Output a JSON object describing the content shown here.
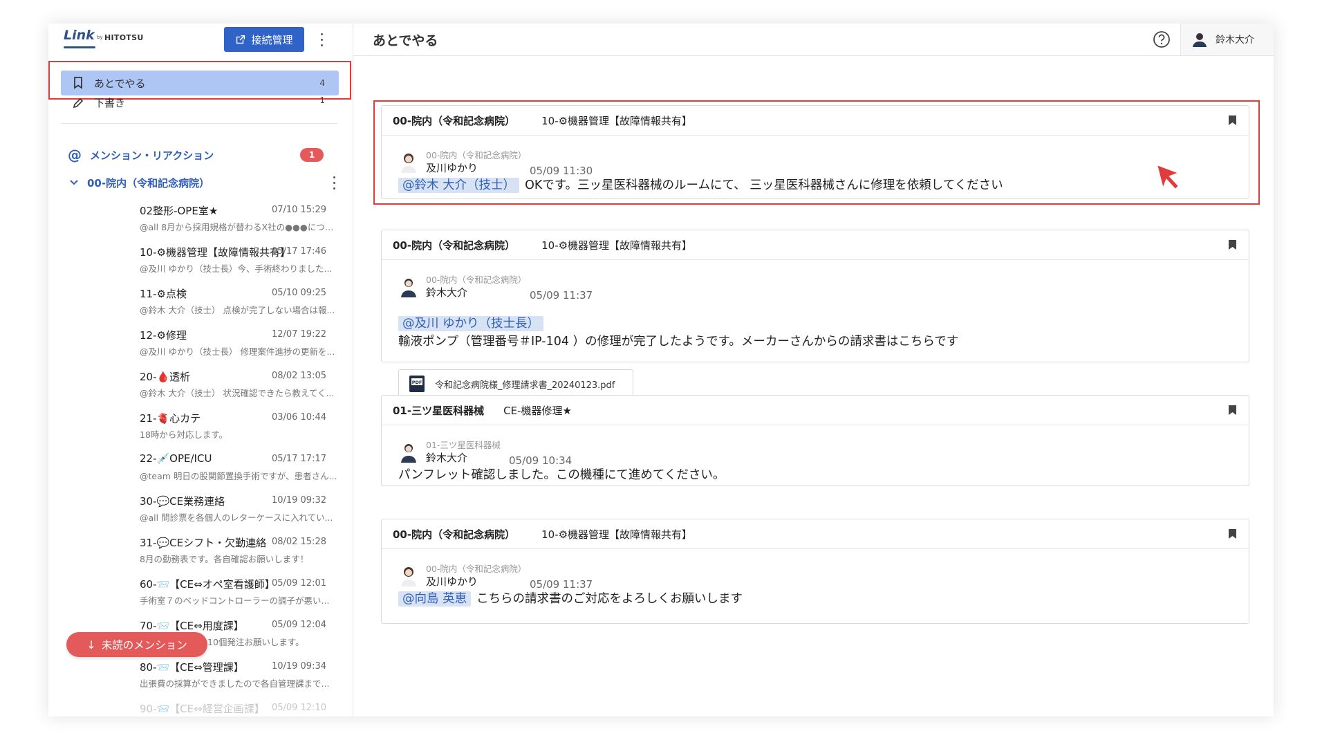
{
  "logo": {
    "brand": "Link",
    "by": "by",
    "company": "HITOTSU"
  },
  "sidebar": {
    "connection_button": "接続管理",
    "nav": [
      {
        "label": "あとでやる",
        "count": "4",
        "icon": "bookmark-icon"
      },
      {
        "label": "下書き",
        "count": "1",
        "icon": "pencil-icon"
      }
    ],
    "mentions": {
      "label": "メンション・リアクション",
      "count": "1"
    },
    "group": {
      "label": "00-院内（令和記念病院）"
    },
    "channels": [
      {
        "name": "02整形-OPE室★",
        "time": "07/10 15:29",
        "preview": "@all 8月から採用規格が替わるX社の●●●につい..."
      },
      {
        "name": "10-⚙機器管理【故障情報共有】",
        "time": "05/17 17:46",
        "preview": "@及川 ゆかり（技士長）今、手術終わりました..."
      },
      {
        "name": "11-⚙点検",
        "time": "05/10 09:25",
        "preview": "@鈴木 大介（技士） 点検が完了しない場合は報..."
      },
      {
        "name": "12-⚙修理",
        "time": "12/07 19:22",
        "preview": "@及川 ゆかり（技士長） 修理案件進捗の更新を..."
      },
      {
        "name": "20-🩸透析",
        "time": "08/02 13:05",
        "preview": "@鈴木 大介（技士） 状況確認できたら教えてく..."
      },
      {
        "name": "21-🫀心カテ",
        "time": "03/06 10:44",
        "preview": "18時から対応します。"
      },
      {
        "name": "22-💉OPE/ICU",
        "time": "05/17 17:17",
        "preview": "@team 明日の股関節置換手術ですが、患者さん..."
      },
      {
        "name": "30-💬CE業務連絡",
        "time": "10/19 09:32",
        "preview": "@all 問診票を各個人のレターケースに入れてい..."
      },
      {
        "name": "31-💬CEシフト・欠勤連絡",
        "time": "08/02 15:28",
        "preview": "8月の勤務表です。各自確認お願いします！"
      },
      {
        "name": "60-📨【CE⇔オペ室看護師】",
        "time": "05/09 12:01",
        "preview": "手術室７のベッドコントローラーの調子が悪い..."
      },
      {
        "name": "70-📨【CE⇔用度課】",
        "time": "05/09 12:04",
        "preview": "10個発注お願いします。"
      },
      {
        "name": "80-📨【CE⇔管理課】",
        "time": "10/19 09:34",
        "preview": "出張費の採算ができましたので各自管理課まで..."
      },
      {
        "name": "90-📨【CE⇔経営企画課】",
        "time": "05/09 12:10",
        "preview": ""
      }
    ],
    "unread_pill": "未読のメンション"
  },
  "main": {
    "title": "あとでやる",
    "user_name": "鈴木大介",
    "cards": [
      {
        "workspace": "00-院内（令和記念病院）",
        "channel": "10-⚙機器管理【故障情報共有】",
        "source": "00-院内（令和記念病院）",
        "user": "及川ゆかり",
        "time": "05/09 11:30",
        "mention": "@鈴木 大介（技士）",
        "text": "OKです。三ッ星医科器械のルームにて、 三ッ星医科器械さんに修理を依頼してください"
      },
      {
        "workspace": "00-院内（令和記念病院）",
        "channel": "10-⚙機器管理【故障情報共有】",
        "source": "00-院内（令和記念病院）",
        "user": "鈴木大介",
        "time": "05/09 11:37",
        "mention": "@及川 ゆかり（技士長）",
        "text": "輸液ポンプ（管理番号＃IP-104 ）の修理が完了したようです。メーカーさんからの請求書はこちらです",
        "attachment": "令和記念病院様_修理請求書_20240123.pdf"
      },
      {
        "workspace": "01-三ツ星医科器械",
        "channel": "CE-機器修理★",
        "source": "01-三ツ星医科器械",
        "user": "鈴木大介",
        "time": "05/09 10:34",
        "text": "パンフレット確認しました。この機種にて進めてください。"
      },
      {
        "workspace": "00-院内（令和記念病院）",
        "channel": "10-⚙機器管理【故障情報共有】",
        "source": "00-院内（令和記念病院）",
        "user": "及川ゆかり",
        "time": "05/09 11:37",
        "mention": "@向島 英恵",
        "text": "こちらの請求書のご対応をよろしくお願いします"
      }
    ]
  },
  "colors": {
    "accent": "#2f63c8",
    "active_nav": "#adc6f3",
    "badge": "#e45a5a",
    "highlight_box": "#e23b3b"
  }
}
